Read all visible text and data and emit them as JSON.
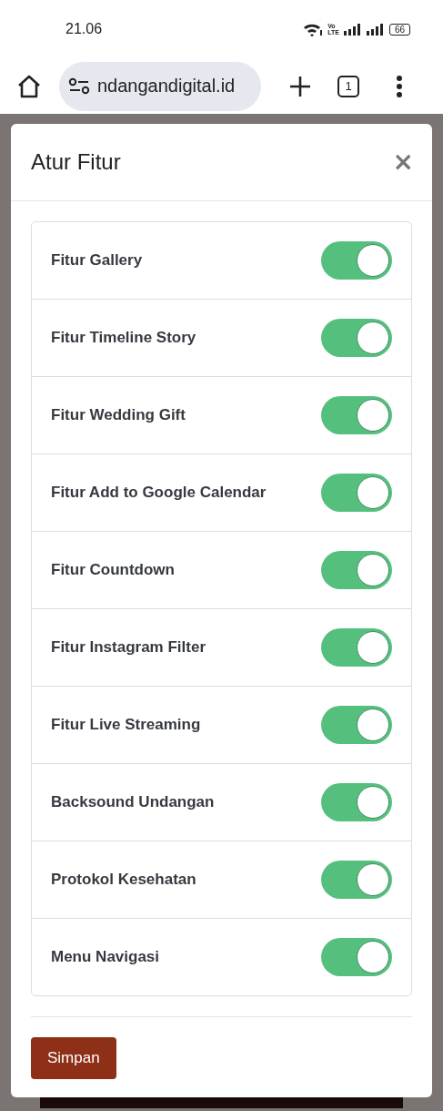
{
  "status_bar": {
    "time": "21.06",
    "network_badge": [
      "Vo",
      "LTE"
    ],
    "battery": "66"
  },
  "browser": {
    "url": "ndangandigital.id",
    "tab_count": "1"
  },
  "dialog": {
    "title": "Atur Fitur",
    "close": "×",
    "features": [
      {
        "label": "Fitur Gallery",
        "on": true
      },
      {
        "label": "Fitur Timeline Story",
        "on": true
      },
      {
        "label": "Fitur Wedding Gift",
        "on": true
      },
      {
        "label": "Fitur Add to Google Calendar",
        "on": true
      },
      {
        "label": "Fitur Countdown",
        "on": true
      },
      {
        "label": "Fitur Instagram Filter",
        "on": true
      },
      {
        "label": "Fitur Live Streaming",
        "on": true
      },
      {
        "label": "Backsound Undangan",
        "on": true
      },
      {
        "label": "Protokol Kesehatan",
        "on": true
      },
      {
        "label": "Menu Navigasi",
        "on": true
      }
    ],
    "save_button": "Simpan"
  }
}
